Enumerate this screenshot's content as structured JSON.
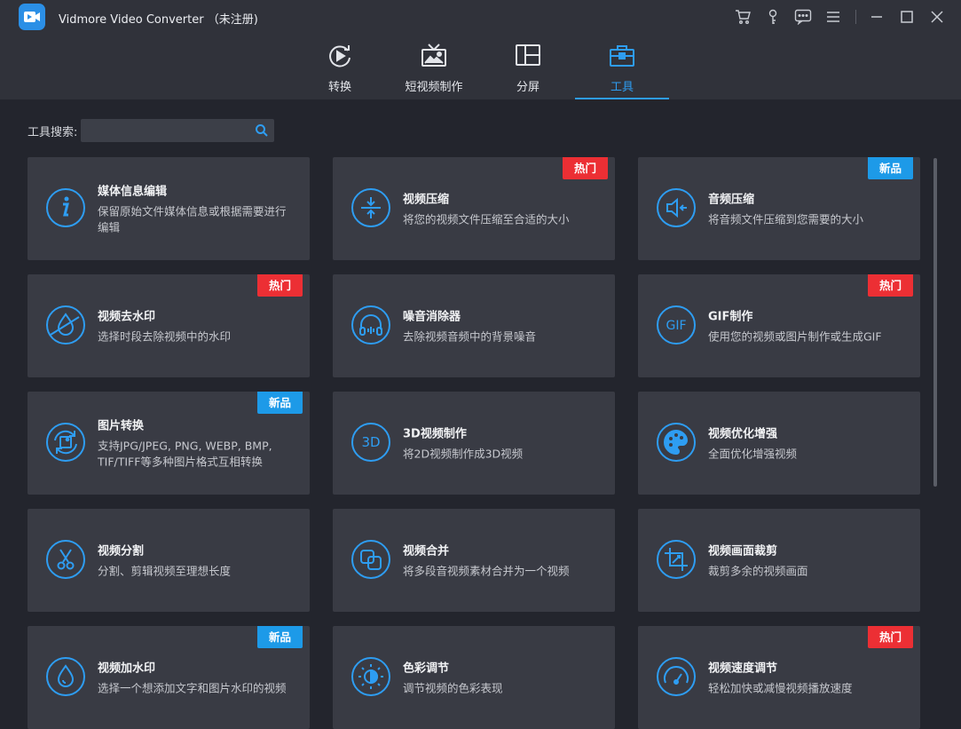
{
  "app": {
    "title": "Vidmore Video Converter （未注册)"
  },
  "window_icons": [
    "cart-icon",
    "key-icon",
    "feedback-icon",
    "menu-icon",
    "minimize-icon",
    "maximize-icon",
    "close-icon"
  ],
  "tabs": [
    {
      "label": "转换",
      "icon": "convert-icon",
      "active": false
    },
    {
      "label": "短视频制作",
      "icon": "mv-icon",
      "active": false
    },
    {
      "label": "分屏",
      "icon": "collage-icon",
      "active": false
    },
    {
      "label": "工具",
      "icon": "toolbox-icon",
      "active": true
    }
  ],
  "search": {
    "label": "工具搜索:",
    "placeholder": "",
    "value": ""
  },
  "colors": {
    "accent": "#2e9df2",
    "hot": "#ec2f34",
    "new": "#1d9ae8",
    "card": "#393b44",
    "background": "#23252d"
  },
  "tools": [
    {
      "title": "媒体信息编辑",
      "desc": "保留原始文件媒体信息或根据需要进行编辑",
      "icon": "info-icon",
      "badge": ""
    },
    {
      "title": "视频压缩",
      "desc": "将您的视频文件压缩至合适的大小",
      "icon": "video-compress-icon",
      "badge": "热门"
    },
    {
      "title": "音频压缩",
      "desc": "将音频文件压缩到您需要的大小",
      "icon": "audio-compress-icon",
      "badge": "新品"
    },
    {
      "title": "视频去水印",
      "desc": "选择时段去除视频中的水印",
      "icon": "remove-watermark-icon",
      "badge": "热门"
    },
    {
      "title": "噪音消除器",
      "desc": "去除视频音频中的背景噪音",
      "icon": "headphones-icon",
      "badge": ""
    },
    {
      "title": "GIF制作",
      "desc": "使用您的视频或图片制作或生成GIF",
      "icon": "gif-icon",
      "badge": "热门"
    },
    {
      "title": "图片转换",
      "desc": "支持JPG/JPEG, PNG, WEBP, BMP, TIF/TIFF等多种图片格式互相转换",
      "icon": "image-convert-icon",
      "badge": "新品"
    },
    {
      "title": "3D视频制作",
      "desc": "将2D视频制作成3D视频",
      "icon": "3d-icon",
      "badge": ""
    },
    {
      "title": "视频优化增强",
      "desc": "全面优化增强视频",
      "icon": "palette-icon",
      "badge": ""
    },
    {
      "title": "视频分割",
      "desc": "分割、剪辑视频至理想长度",
      "icon": "scissors-icon",
      "badge": ""
    },
    {
      "title": "视频合并",
      "desc": "将多段音视频素材合并为一个视频",
      "icon": "merge-icon",
      "badge": ""
    },
    {
      "title": "视频画面裁剪",
      "desc": "裁剪多余的视频画面",
      "icon": "crop-icon",
      "badge": ""
    },
    {
      "title": "视频加水印",
      "desc": "选择一个想添加文字和图片水印的视频",
      "icon": "watermark-drop-icon",
      "badge": "新品"
    },
    {
      "title": "色彩调节",
      "desc": "调节视频的色彩表现",
      "icon": "color-adjust-icon",
      "badge": ""
    },
    {
      "title": "视频速度调节",
      "desc": "轻松加快或减慢视频播放速度",
      "icon": "speedometer-icon",
      "badge": "热门"
    }
  ]
}
